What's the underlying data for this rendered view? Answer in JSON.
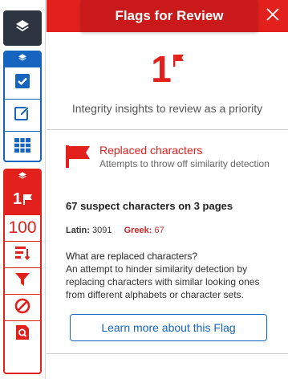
{
  "colors": {
    "accent_red": "#e2211c",
    "header_dark_red": "#c9191a",
    "accent_blue": "#1565c0",
    "toolbar_dark": "#2d3540",
    "greek_red": "#c62828"
  },
  "toolbar": {
    "top_icon": "layers-icon",
    "blue_group": {
      "header_icon": "layers-icon",
      "items": [
        {
          "icon": "checkbox-icon"
        },
        {
          "icon": "edit-icon"
        },
        {
          "icon": "grid-icon"
        }
      ]
    },
    "red_group": {
      "header_icon": "layers-icon",
      "flag_count": "1",
      "flag_icon": "flag-icon",
      "score": "100",
      "items": [
        {
          "icon": "sort-icon"
        },
        {
          "icon": "filter-icon"
        },
        {
          "icon": "exclude-icon"
        },
        {
          "icon": "document-search-icon"
        }
      ]
    }
  },
  "panel": {
    "title": "Flags for Review",
    "close_icon": "close-icon",
    "flag_count": "1",
    "subtitle": "Integrity insights to review as a priority",
    "flag": {
      "icon": "flag-icon",
      "title": "Replaced characters",
      "description": "Attempts to throw off similarity detection"
    },
    "suspect_summary": "67 suspect characters on 3 pages",
    "alphabets": {
      "latin_label": "Latin:",
      "latin_value": "3091",
      "greek_label": "Greek:",
      "greek_value": "67"
    },
    "explanation_title": "What are replaced characters?",
    "explanation_body": "An attempt to hinder similarity detection by replacing characters with similar looking ones from different alphabets or character sets.",
    "learn_more_label": "Learn more about this Flag"
  }
}
